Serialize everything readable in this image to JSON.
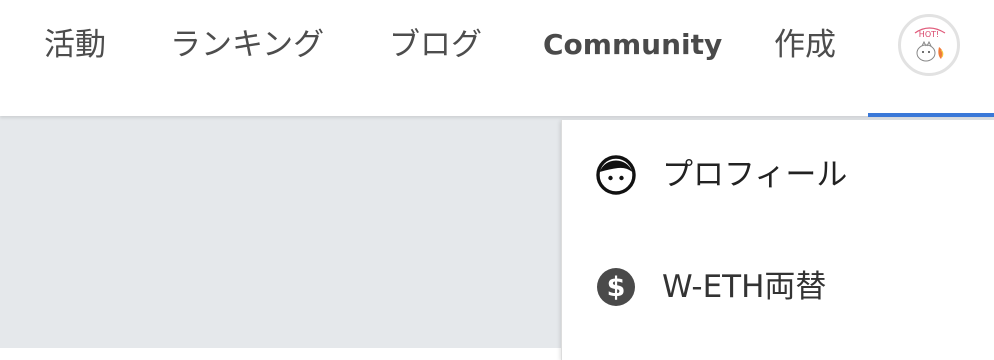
{
  "colors": {
    "accent": "#3a78d8",
    "content_background": "#e5e8eb",
    "icon_dark": "#111111",
    "icon_gray": "#4a4a4a"
  },
  "nav": {
    "items": [
      {
        "label": "活動"
      },
      {
        "label": "ランキング"
      },
      {
        "label": "ブログ"
      },
      {
        "label": "Community"
      },
      {
        "label": "作成"
      }
    ],
    "avatar_badge": "HOT!"
  },
  "dropdown": {
    "items": [
      {
        "label": "プロフィール",
        "icon": "face-icon"
      },
      {
        "label": "W-ETH両替",
        "icon": "dollar-circle-icon"
      }
    ]
  }
}
